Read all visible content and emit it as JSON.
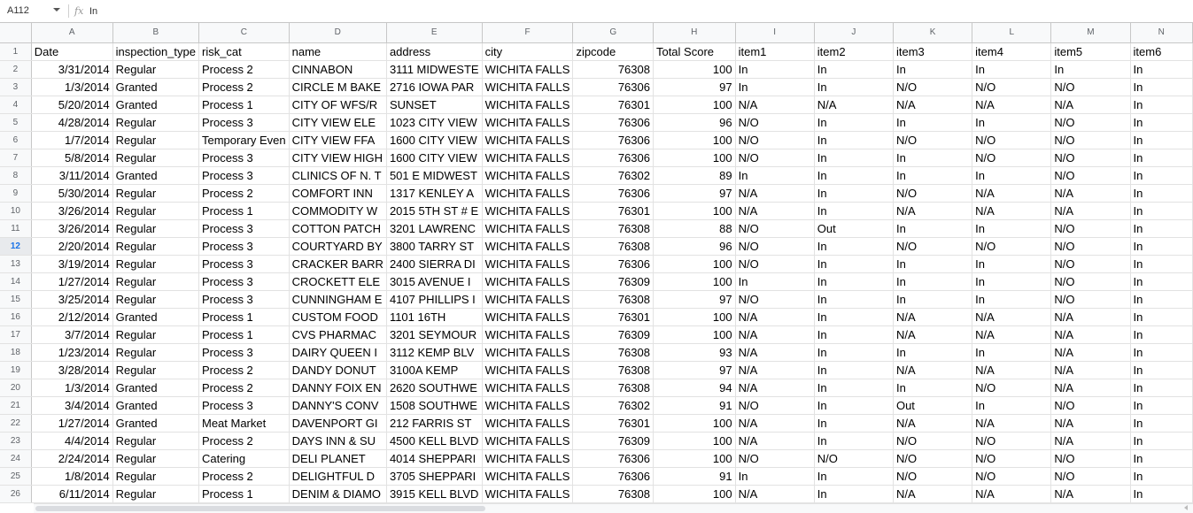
{
  "formula_bar": {
    "cell_ref": "A112",
    "fx": "fx",
    "value": "In"
  },
  "sheet": {
    "selected_row": "12",
    "column_letters": [
      "A",
      "B",
      "C",
      "D",
      "E",
      "F",
      "G",
      "H",
      "I",
      "J",
      "K",
      "L",
      "M",
      "N"
    ],
    "column_types": [
      "num",
      "txt",
      "txt",
      "txt",
      "txt",
      "txt",
      "num",
      "num",
      "txt",
      "txt",
      "txt",
      "txt",
      "txt",
      "txt"
    ],
    "rows": [
      {
        "n": "1",
        "cells": [
          "Date",
          "inspection_type",
          "risk_cat",
          "name",
          "address",
          "city",
          "zipcode",
          "Total Score",
          "item1",
          "item2",
          "item3",
          "item4",
          "item5",
          "item6"
        ]
      },
      {
        "n": "2",
        "cells": [
          "3/31/2014",
          "Regular",
          "Process 2",
          "CINNABON",
          "3111 MIDWESTE",
          "WICHITA FALLS",
          "76308",
          "100",
          "In",
          "In",
          "In",
          "In",
          "In",
          "In"
        ]
      },
      {
        "n": "3",
        "cells": [
          "1/3/2014",
          "Granted",
          "Process 2",
          "CIRCLE M BAKE",
          "2716 IOWA PAR",
          "WICHITA FALLS",
          "76306",
          "97",
          "In",
          "In",
          "N/O",
          "N/O",
          "N/O",
          "In"
        ]
      },
      {
        "n": "4",
        "cells": [
          "5/20/2014",
          "Granted",
          "Process 1",
          "CITY OF WFS/R",
          "SUNSET",
          "WICHITA FALLS",
          "76301",
          "100",
          "N/A",
          "N/A",
          "N/A",
          "N/A",
          "N/A",
          "In"
        ]
      },
      {
        "n": "5",
        "cells": [
          "4/28/2014",
          "Regular",
          "Process 3",
          "CITY VIEW ELE",
          "1023 CITY VIEW",
          "WICHITA FALLS",
          "76306",
          "96",
          "N/O",
          "In",
          "In",
          "In",
          "N/O",
          "In"
        ]
      },
      {
        "n": "6",
        "cells": [
          "1/7/2014",
          "Regular",
          "Temporary Even",
          "CITY VIEW FFA",
          "1600 CITY VIEW",
          "WICHITA FALLS",
          "76306",
          "100",
          "N/O",
          "In",
          "N/O",
          "N/O",
          "N/O",
          "In"
        ]
      },
      {
        "n": "7",
        "cells": [
          "5/8/2014",
          "Regular",
          "Process 3",
          "CITY VIEW HIGH",
          "1600 CITY VIEW",
          "WICHITA FALLS",
          "76306",
          "100",
          "N/O",
          "In",
          "In",
          "N/O",
          "N/O",
          "In"
        ]
      },
      {
        "n": "8",
        "cells": [
          "3/11/2014",
          "Granted",
          "Process 3",
          "CLINICS OF N. T",
          "501 E MIDWEST",
          "WICHITA FALLS",
          "76302",
          "89",
          "In",
          "In",
          "In",
          "In",
          "N/O",
          "In"
        ]
      },
      {
        "n": "9",
        "cells": [
          "5/30/2014",
          "Regular",
          "Process 2",
          "COMFORT INN",
          "1317 KENLEY A",
          "WICHITA FALLS",
          "76306",
          "97",
          "N/A",
          "In",
          "N/O",
          "N/A",
          "N/A",
          "In"
        ]
      },
      {
        "n": "10",
        "cells": [
          "3/26/2014",
          "Regular",
          "Process 1",
          "COMMODITY W",
          "2015 5TH ST # E",
          "WICHITA FALLS",
          "76301",
          "100",
          "N/A",
          "In",
          "N/A",
          "N/A",
          "N/A",
          "In"
        ]
      },
      {
        "n": "11",
        "cells": [
          "3/26/2014",
          "Regular",
          "Process 3",
          "COTTON PATCH",
          "3201 LAWRENC",
          "WICHITA FALLS",
          "76308",
          "88",
          "N/O",
          "Out",
          "In",
          "In",
          "N/O",
          "In"
        ]
      },
      {
        "n": "12",
        "cells": [
          "2/20/2014",
          "Regular",
          "Process 3",
          "COURTYARD BY",
          "3800 TARRY ST",
          "WICHITA FALLS",
          "76308",
          "96",
          "N/O",
          "In",
          "N/O",
          "N/O",
          "N/O",
          "In"
        ]
      },
      {
        "n": "13",
        "cells": [
          "3/19/2014",
          "Regular",
          "Process 3",
          "CRACKER BARR",
          "2400 SIERRA DI",
          "WICHITA FALLS",
          "76306",
          "100",
          "N/O",
          "In",
          "In",
          "In",
          "N/O",
          "In"
        ]
      },
      {
        "n": "14",
        "cells": [
          "1/27/2014",
          "Regular",
          "Process 3",
          "CROCKETT ELE",
          "3015 AVENUE I",
          "WICHITA FALLS",
          "76309",
          "100",
          "In",
          "In",
          "In",
          "In",
          "N/O",
          "In"
        ]
      },
      {
        "n": "15",
        "cells": [
          "3/25/2014",
          "Regular",
          "Process 3",
          "CUNNINGHAM E",
          "4107 PHILLIPS I",
          "WICHITA FALLS",
          "76308",
          "97",
          "N/O",
          "In",
          "In",
          "In",
          "N/O",
          "In"
        ]
      },
      {
        "n": "16",
        "cells": [
          "2/12/2014",
          "Granted",
          "Process 1",
          "CUSTOM FOOD",
          "1101 16TH",
          "WICHITA FALLS",
          "76301",
          "100",
          "N/A",
          "In",
          "N/A",
          "N/A",
          "N/A",
          "In"
        ]
      },
      {
        "n": "17",
        "cells": [
          "3/7/2014",
          "Regular",
          "Process 1",
          "CVS PHARMAC",
          "3201 SEYMOUR",
          "WICHITA FALLS",
          "76309",
          "100",
          "N/A",
          "In",
          "N/A",
          "N/A",
          "N/A",
          "In"
        ]
      },
      {
        "n": "18",
        "cells": [
          "1/23/2014",
          "Regular",
          "Process 3",
          "DAIRY QUEEN I",
          "3112 KEMP BLV",
          "WICHITA FALLS",
          "76308",
          "93",
          "N/A",
          "In",
          "In",
          "In",
          "N/A",
          "In"
        ]
      },
      {
        "n": "19",
        "cells": [
          "3/28/2014",
          "Regular",
          "Process 2",
          "DANDY DONUT",
          "3100A KEMP",
          "WICHITA FALLS",
          "76308",
          "97",
          "N/A",
          "In",
          "N/A",
          "N/A",
          "N/A",
          "In"
        ]
      },
      {
        "n": "20",
        "cells": [
          "1/3/2014",
          "Granted",
          "Process 2",
          "DANNY FOIX EN",
          "2620 SOUTHWE",
          "WICHITA FALLS",
          "76308",
          "94",
          "N/A",
          "In",
          "In",
          "N/O",
          "N/A",
          "In"
        ]
      },
      {
        "n": "21",
        "cells": [
          "3/4/2014",
          "Granted",
          "Process 3",
          "DANNY'S CONV",
          "1508 SOUTHWE",
          "WICHITA FALLS",
          "76302",
          "91",
          "N/O",
          "In",
          "Out",
          "In",
          "N/O",
          "In"
        ]
      },
      {
        "n": "22",
        "cells": [
          "1/27/2014",
          "Granted",
          "Meat Market",
          "DAVENPORT GI",
          "212 FARRIS ST",
          "WICHITA FALLS",
          "76301",
          "100",
          "N/A",
          "In",
          "N/A",
          "N/A",
          "N/A",
          "In"
        ]
      },
      {
        "n": "23",
        "cells": [
          "4/4/2014",
          "Regular",
          "Process 2",
          "DAYS INN & SU",
          "4500 KELL BLVD",
          "WICHITA FALLS",
          "76309",
          "100",
          "N/A",
          "In",
          "N/O",
          "N/O",
          "N/A",
          "In"
        ]
      },
      {
        "n": "24",
        "cells": [
          "2/24/2014",
          "Regular",
          "Catering",
          "DELI PLANET",
          "4014 SHEPPARI",
          "WICHITA FALLS",
          "76306",
          "100",
          "N/O",
          "N/O",
          "N/O",
          "N/O",
          "N/O",
          "In"
        ]
      },
      {
        "n": "25",
        "cells": [
          "1/8/2014",
          "Regular",
          "Process 2",
          "DELIGHTFUL D",
          "3705 SHEPPARI",
          "WICHITA FALLS",
          "76306",
          "91",
          "In",
          "In",
          "N/O",
          "N/O",
          "N/O",
          "In"
        ]
      },
      {
        "n": "26",
        "cells": [
          "6/11/2014",
          "Regular",
          "Process 1",
          "DENIM & DIAMO",
          "3915 KELL BLVD",
          "WICHITA FALLS",
          "76308",
          "100",
          "N/A",
          "In",
          "N/A",
          "N/A",
          "N/A",
          "In"
        ]
      }
    ]
  }
}
